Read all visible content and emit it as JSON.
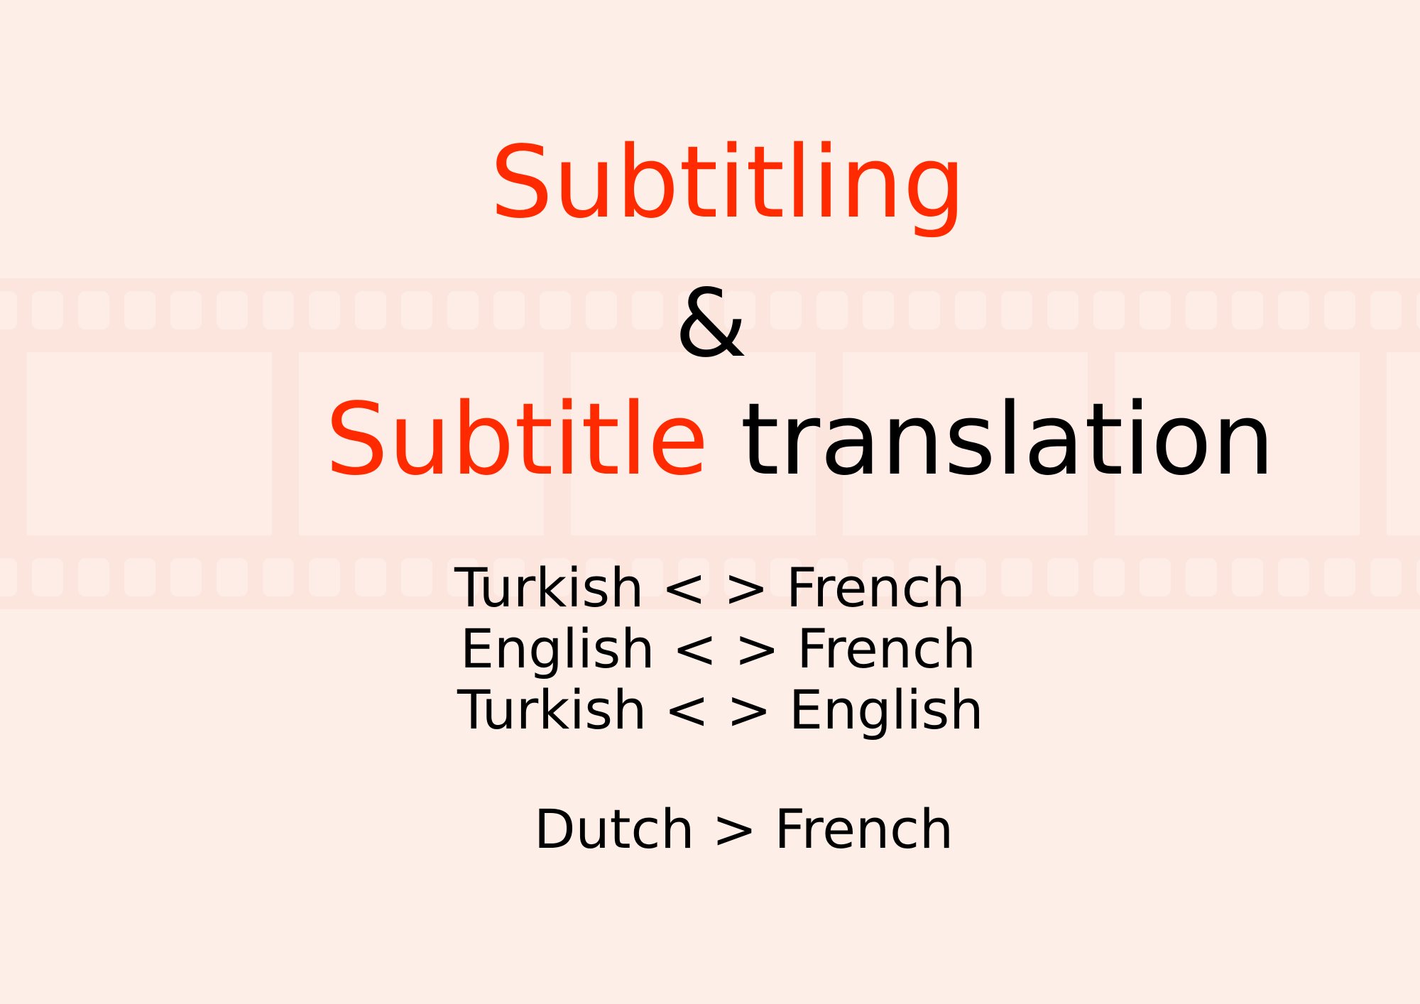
{
  "title_line_1": "Subtitling",
  "ampersand": "&",
  "title_line_2": {
    "red_part": "Subtitle",
    "black_part": "translation"
  },
  "language_pairs": [
    "Turkish < > French",
    "English < > French",
    "Turkish < > English",
    "Dutch > French"
  ],
  "colors": {
    "background": "#fdefe7",
    "accent_red": "#ff2a00",
    "text_black": "#000000",
    "filmstrip_tint": "#f9e2d9"
  }
}
